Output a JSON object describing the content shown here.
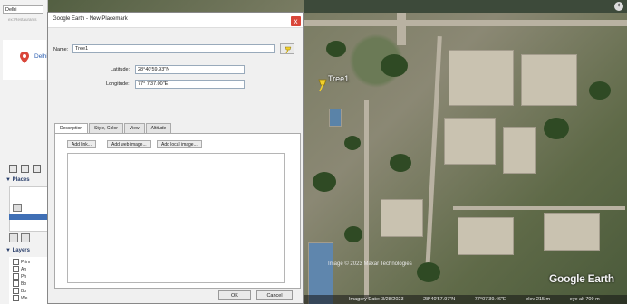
{
  "sidebar": {
    "search_value": "Delhi",
    "search_hint": "ex: Restaurants",
    "result_label": "Delhi",
    "places_title": "Places",
    "layers_title": "Layers",
    "layer_items": [
      "Prim",
      "An",
      "Ph",
      "Bo",
      "Bo",
      "We"
    ]
  },
  "dialog": {
    "title": "Google Earth - New Placemark",
    "close_symbol": "x",
    "name_label": "Name:",
    "name_value": "Tree1",
    "latitude_label": "Latitude:",
    "latitude_value": "28°40'59.93\"N",
    "longitude_label": "Longitude:",
    "longitude_value": "77° 7'37.00\"E",
    "tabs": [
      "Description",
      "Style, Color",
      "View",
      "Altitude"
    ],
    "add_link": "Add link...",
    "add_web_image": "Add web image...",
    "add_local_image": "Add local image...",
    "ok": "OK",
    "cancel": "Cancel"
  },
  "map": {
    "pin_label": "Tree1",
    "credit": "Image © 2023 Maxar Technologies",
    "logo": "Google Earth",
    "status": [
      "Imagery Date: 3/28/2023",
      "28°40'57.97\"N",
      "77°07'39.46\"E",
      "elev 215 m",
      "eye alt 709 m"
    ]
  },
  "colors": {
    "accent_red": "#d9463a",
    "selection_blue": "#3f6fb5",
    "pin_yellow": "#f2d02a"
  }
}
